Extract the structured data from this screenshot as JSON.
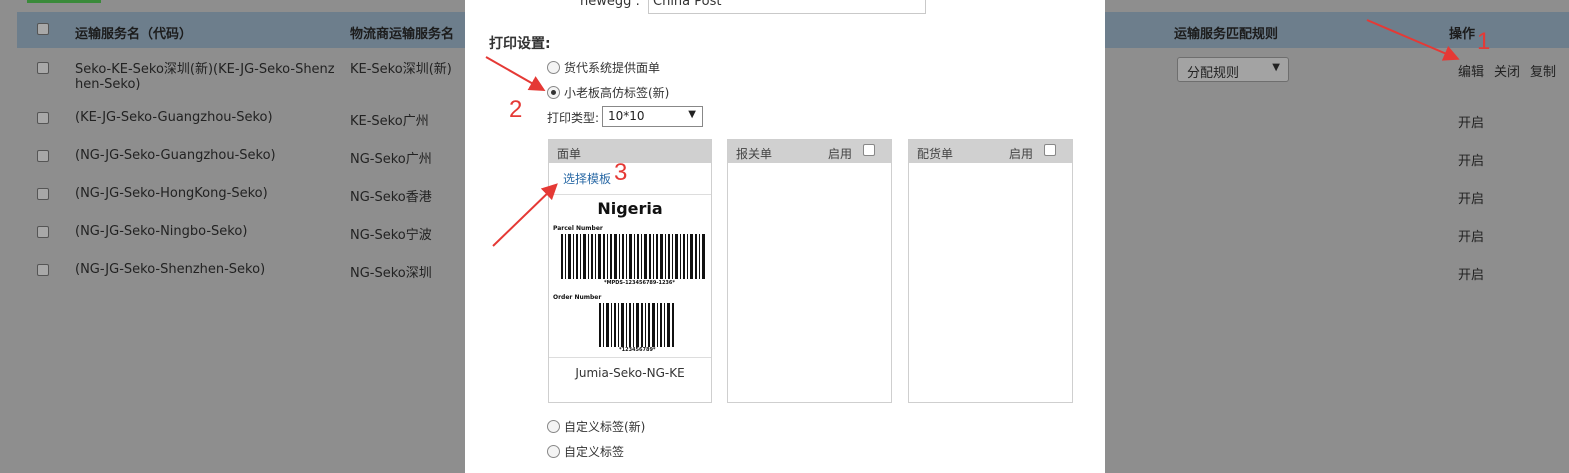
{
  "background_table": {
    "headers": {
      "name": "运输服务名（代码）",
      "provider": "物流商运输服务名",
      "rule": "运输服务匹配规则",
      "actions": "操作"
    },
    "rows": [
      {
        "name_line1": "Seko-KE-Seko深圳(新)(KE-JG-Seko-Shenz",
        "name_line2": "hen-Seko)",
        "provider": "KE-Seko深圳(新)"
      },
      {
        "name_line1": "(KE-JG-Seko-Guangzhou-Seko)",
        "provider": "KE-Seko广州",
        "action": "开启"
      },
      {
        "name_line1": "(NG-JG-Seko-Guangzhou-Seko)",
        "provider": "NG-Seko广州",
        "action": "开启"
      },
      {
        "name_line1": "(NG-JG-Seko-HongKong-Seko)",
        "provider": "NG-Seko香港",
        "action": "开启"
      },
      {
        "name_line1": "(NG-JG-Seko-Ningbo-Seko)",
        "provider": "NG-Seko宁波",
        "action": "开启"
      },
      {
        "name_line1": "(NG-JG-Seko-Shenzhen-Seko)",
        "provider": "NG-Seko深圳",
        "action": "开启"
      }
    ],
    "rule_select": "分配规则",
    "row1_actions": {
      "edit": "编辑",
      "close": "关闭",
      "copy": "复制"
    }
  },
  "modal": {
    "top_field_label": "newegg :",
    "top_field_value": "China Post",
    "print_settings_title": "打印设置:",
    "options": {
      "opt1": "货代系统提供面单",
      "opt2": "小老板高仿标签(新)",
      "opt3": "自定义标签(新)",
      "opt4": "自定义标签"
    },
    "selected_option": "小老板高仿标签(新)",
    "print_type_label": "打印类型:",
    "print_type_value": "10*10",
    "panels": {
      "waybill": {
        "title": "面单",
        "choose": "选择模板",
        "template_name": "Jumia-Seko-NG-KE"
      },
      "customs": {
        "title": "报关单",
        "enable": "启用"
      },
      "picking": {
        "title": "配货单",
        "enable": "启用"
      }
    },
    "label_preview": {
      "country": "Nigeria",
      "parcel_label": "Parcel Number",
      "parcel_code": "*MPDS-123456789-1236*",
      "order_label": "Order Number",
      "order_code": "*123456789*"
    }
  },
  "annotations": {
    "n1": "1",
    "n2": "2",
    "n3": "3"
  },
  "colors": {
    "overlay_bg": "#8e8e8e",
    "link": "#2b6aa6",
    "annotation": "#e53935"
  }
}
